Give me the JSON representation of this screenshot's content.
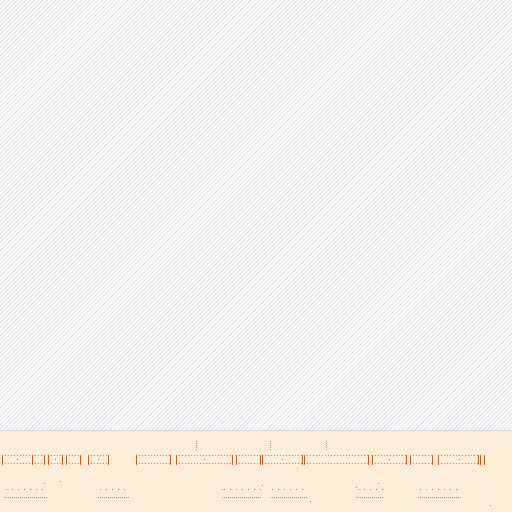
{
  "canvas": {
    "background_color": "#ffffff",
    "hatch_color": "#dcdce2"
  },
  "strip": {
    "background_color": "#fde9cf",
    "mark_color_primary": "#e07a2a",
    "mark_color_secondary": "#c8601a",
    "divider_color": "#d4d4da"
  }
}
